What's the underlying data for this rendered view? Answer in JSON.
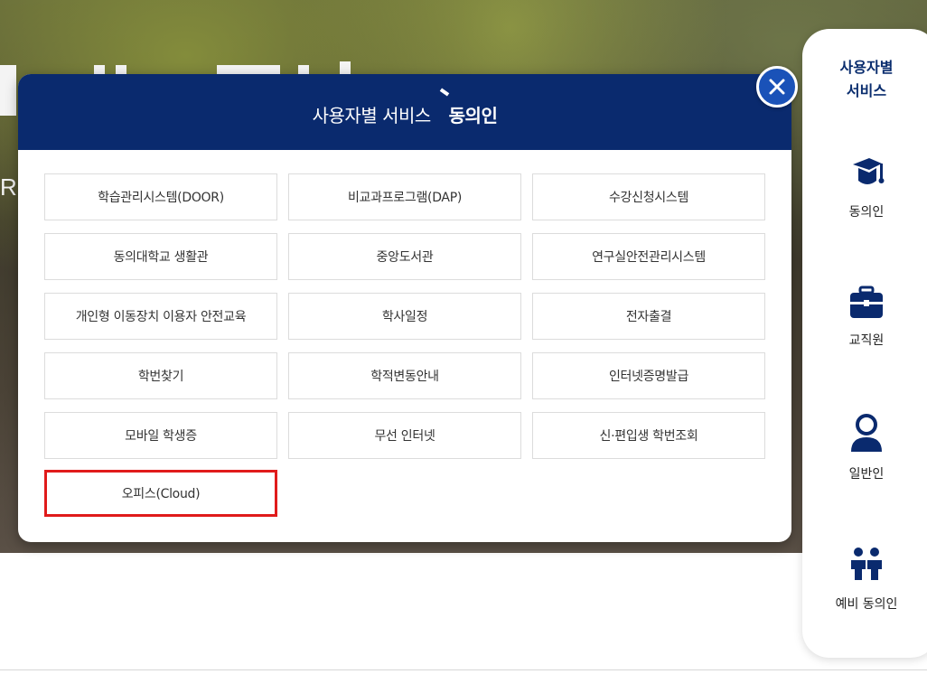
{
  "modal": {
    "title": "사용자별 서비스",
    "brand": "동의인",
    "services": [
      {
        "label": "학습관리시스템(DOOR)"
      },
      {
        "label": "비교과프로그램(DAP)"
      },
      {
        "label": "수강신청시스템"
      },
      {
        "label": "동의대학교 생활관"
      },
      {
        "label": "중앙도서관"
      },
      {
        "label": "연구실안전관리시스템"
      },
      {
        "label": "개인형 이동장치 이용자 안전교육"
      },
      {
        "label": "학사일정"
      },
      {
        "label": "전자출결"
      },
      {
        "label": "학번찾기"
      },
      {
        "label": "학적변동안내"
      },
      {
        "label": "인터넷증명발급"
      },
      {
        "label": "모바일 학생증"
      },
      {
        "label": "무선 인터넷"
      },
      {
        "label": "신·편입생 학번조회"
      },
      {
        "label": "오피스(Cloud)",
        "highlighted": true
      }
    ]
  },
  "sidebar": {
    "title": "사용자별\n서비스",
    "items": [
      {
        "label": "동의인",
        "icon": "graduation-cap-icon"
      },
      {
        "label": "교직원",
        "icon": "briefcase-icon"
      },
      {
        "label": "일반인",
        "icon": "person-icon"
      },
      {
        "label": "예비 동의인",
        "icon": "two-people-icon"
      }
    ]
  },
  "hero": {
    "side_letter": "R"
  },
  "colors": {
    "navy": "#0a2a6e",
    "highlight": "#e01b1b",
    "close": "#1a52b8"
  }
}
